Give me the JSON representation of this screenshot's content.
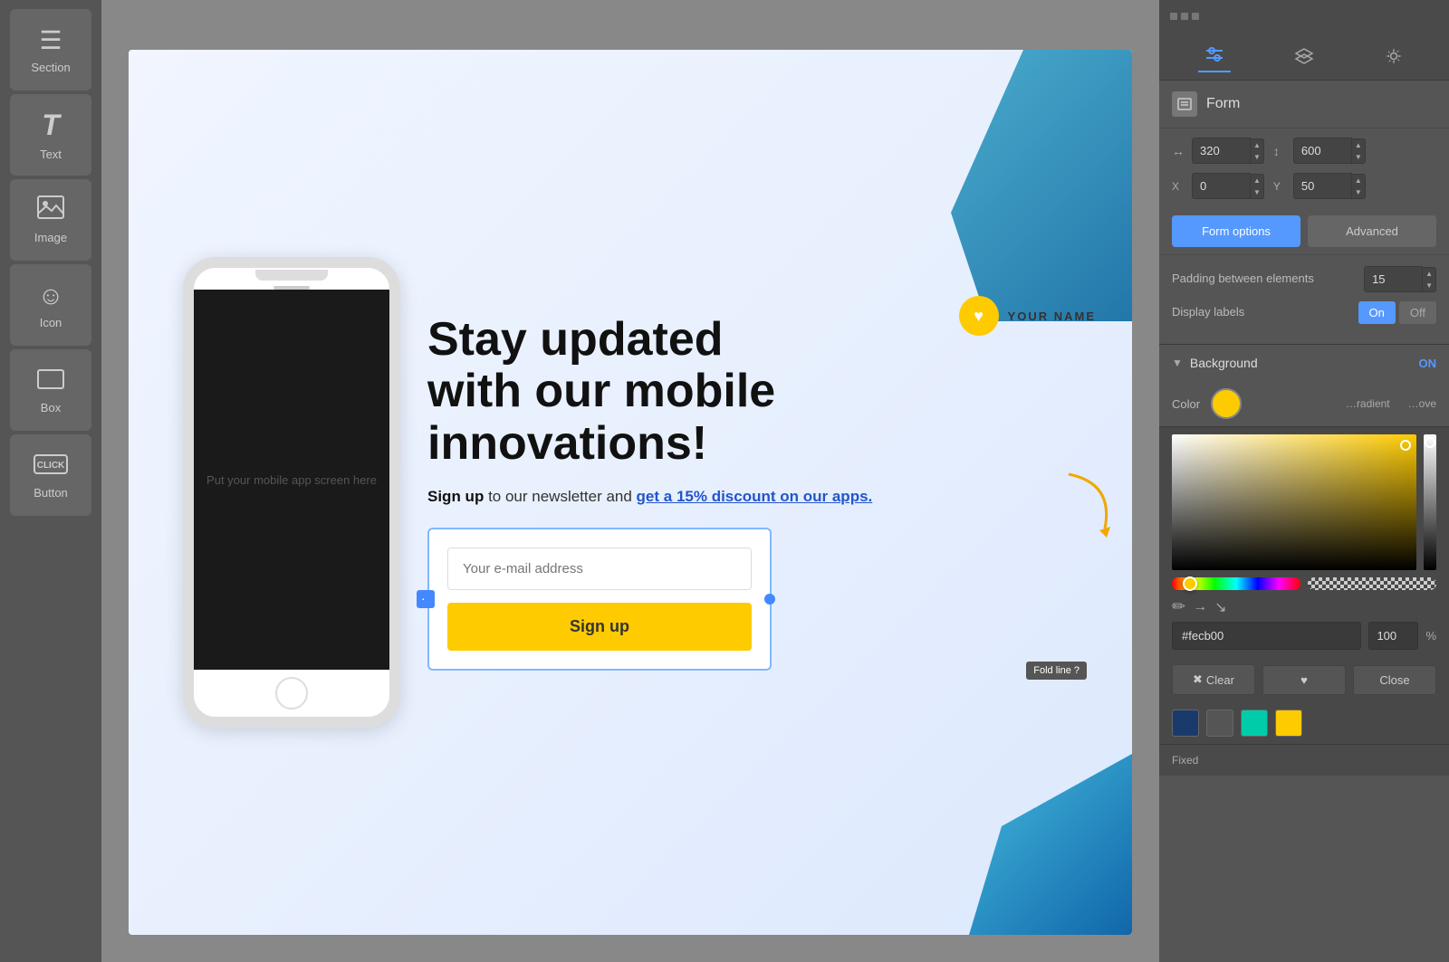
{
  "sidebar": {
    "items": [
      {
        "id": "section",
        "label": "Section",
        "icon": "☰"
      },
      {
        "id": "text",
        "label": "Text",
        "icon": "T"
      },
      {
        "id": "image",
        "label": "Image",
        "icon": "🖼"
      },
      {
        "id": "icon",
        "label": "Icon",
        "icon": "☺"
      },
      {
        "id": "box",
        "label": "Box",
        "icon": "▭"
      },
      {
        "id": "button",
        "label": "Button",
        "icon": "⬜"
      }
    ]
  },
  "canvas": {
    "brand_circle_icon": "♥",
    "brand_name": "YOUR NAME",
    "headline_line1": "Stay updated",
    "headline_line2": "with our mobile",
    "headline_line3": "innovations!",
    "subtext_prefix": "Sign up",
    "subtext_middle": " to our newsletter and ",
    "discount_text": "get a 15% discount on our apps.",
    "email_placeholder": "Your e-mail address",
    "signup_button": "Sign up",
    "phone_text": "Put your mobile app screen here",
    "fold_line_label": "Fold line ?"
  },
  "right_panel": {
    "tabs": [
      {
        "id": "sliders",
        "icon": "⇅",
        "active": true
      },
      {
        "id": "layers",
        "icon": "❑"
      },
      {
        "id": "settings",
        "icon": "⚙"
      }
    ],
    "form_title": "Form",
    "width": "320",
    "height": "600",
    "x": "0",
    "y": "50",
    "buttons": {
      "form_options": "Form options",
      "advanced": "Advanced"
    },
    "padding_label": "Padding between elements",
    "padding_value": "15",
    "display_labels": "Display labels",
    "toggle_on": "On",
    "toggle_off": "Off",
    "background_section": {
      "title": "Background",
      "toggle": "ON",
      "color_label": "Color",
      "color_value": "#fecb00"
    },
    "color_picker": {
      "hex_value": "#fecb00",
      "opacity_value": "100",
      "buttons": {
        "clear": "Clear",
        "favorite": "♥",
        "close": "Close"
      },
      "gradient_label": "radient",
      "remove_label": "ove",
      "preset_colors": [
        "#1a3a6b",
        "#555",
        "#00ccaa",
        "#fecb00"
      ]
    },
    "bottom_label": "Fixed"
  }
}
